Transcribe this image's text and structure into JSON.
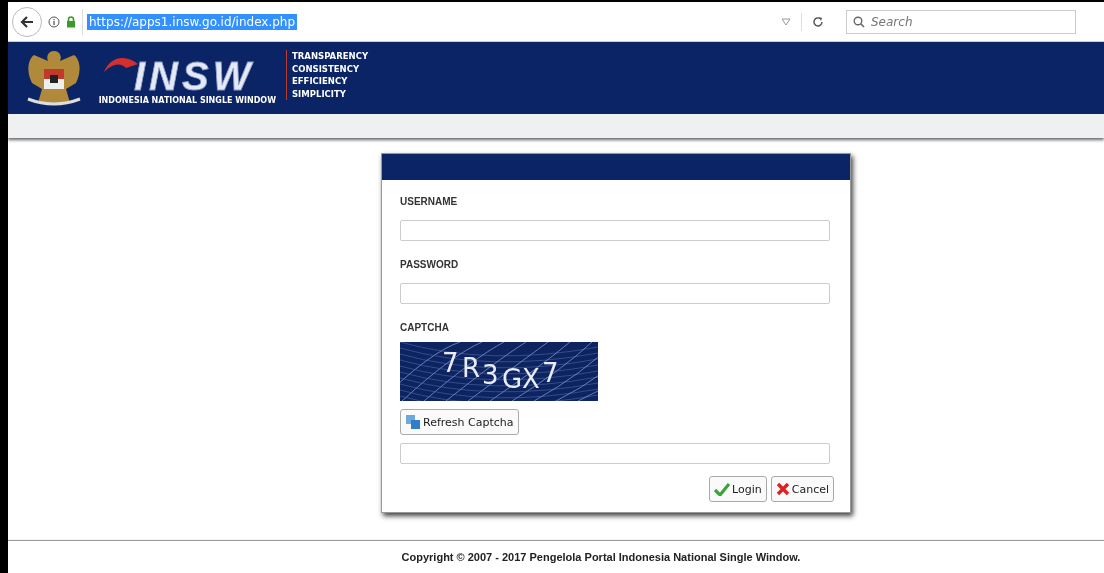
{
  "browser": {
    "url": "https://apps1.insw.go.id/index.php",
    "url_selected": true,
    "search_placeholder": "Search"
  },
  "header": {
    "logo_text": "INSW",
    "logo_subtitle": "INDONESIA NATIONAL SINGLE WINDOW",
    "mottos": [
      "TRANSPARENCY",
      "CONSISTENCY",
      "EFFICIENCY",
      "SIMPLICITY"
    ]
  },
  "login": {
    "fields": [
      {
        "label": "USERNAME"
      },
      {
        "label": "PASSWORD"
      }
    ],
    "captcha_label": "CAPTCHA",
    "captcha_text": "7R3GX7",
    "refresh_button": "Refresh Captcha",
    "buttons": [
      {
        "kind": "ok",
        "label": "Login"
      },
      {
        "kind": "cancel",
        "label": "Cancel"
      }
    ]
  },
  "footer": "Copyright © 2007 - 2017 Pengelola Portal Indonesia National Single Window."
}
